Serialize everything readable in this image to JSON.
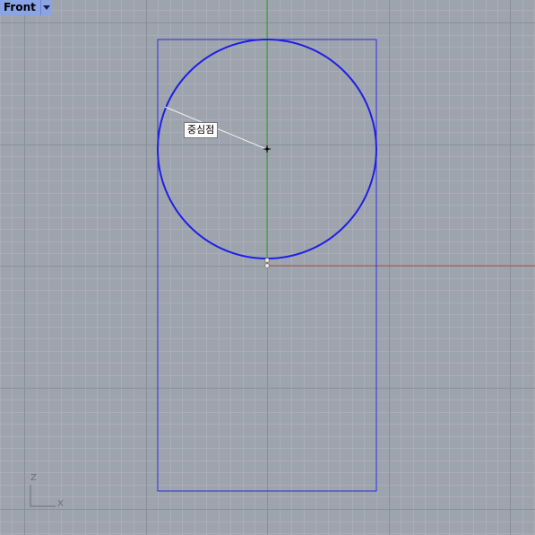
{
  "viewport": {
    "title": "Front",
    "menu_icon": "triangle-down-icon"
  },
  "snap_tooltip": "중심점",
  "axis_indicator": {
    "vertical_label": "Z",
    "horizontal_label": "X"
  },
  "colors": {
    "background": "#9ea4ae",
    "grid_minor": "#a9aeb7",
    "grid_major": "#8a9099",
    "curve": "#1f1fe6",
    "rectangle": "#2a2ae0",
    "x_axis": "#b45050",
    "y_axis": "#3a9a3a",
    "tab_background": "#8aa5e6"
  }
}
